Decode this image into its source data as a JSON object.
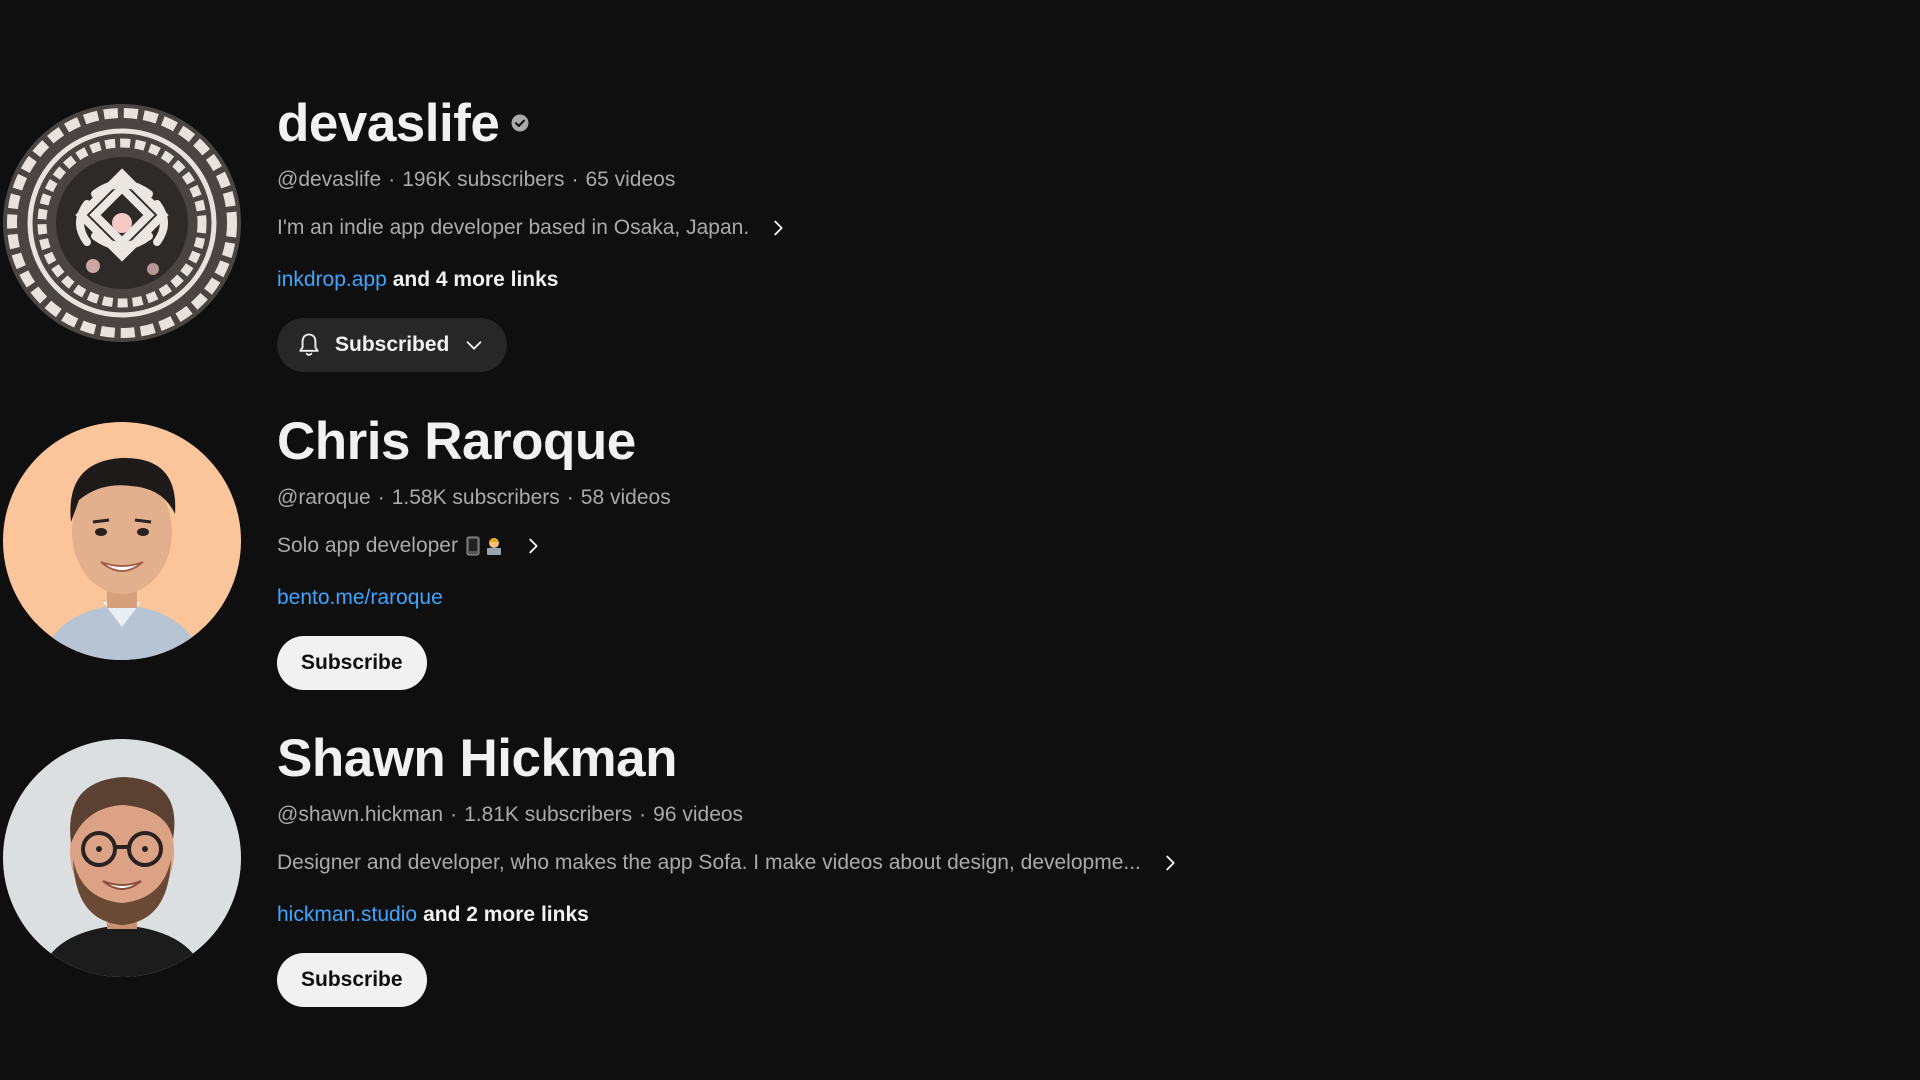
{
  "colors": {
    "background": "#0f0f0f",
    "primary_text": "#f1f1f1",
    "secondary_text": "#aaaaaa",
    "link": "#3ea6ff",
    "subscribed_button_bg": "#272727",
    "subscribe_button_bg": "#f1f1f1"
  },
  "channels": [
    {
      "name": "devaslife",
      "verified": true,
      "verified_icon": "verified-check-icon",
      "handle": "@devaslife",
      "subscribers": "196K subscribers",
      "videos": "65 videos",
      "description": "I'm an indie app developer based in Osaka, Japan.",
      "link": "inkdrop.app",
      "more_links": "and 4 more links",
      "button_label": "Subscribed",
      "button_state": "subscribed",
      "avatar_icon": "ornamental-emblem-avatar"
    },
    {
      "name": "Chris Raroque",
      "verified": false,
      "handle": "@raroque",
      "subscribers": "1.58K subscribers",
      "videos": "58 videos",
      "description": "Solo app developer",
      "description_emoji": [
        "mobile-phone-icon",
        "technologist-icon"
      ],
      "link": "bento.me/raroque",
      "more_links": "",
      "button_label": "Subscribe",
      "button_state": "not-subscribed",
      "avatar_icon": "person-avatar-peach"
    },
    {
      "name": "Shawn Hickman",
      "verified": false,
      "handle": "@shawn.hickman",
      "subscribers": "1.81K subscribers",
      "videos": "96 videos",
      "description": "Designer and developer, who makes the app Sofa. I make videos about design, developme...",
      "link": "hickman.studio",
      "more_links": "and 2 more links",
      "button_label": "Subscribe",
      "button_state": "not-subscribed",
      "avatar_icon": "person-avatar-glasses"
    }
  ],
  "separator": "·"
}
